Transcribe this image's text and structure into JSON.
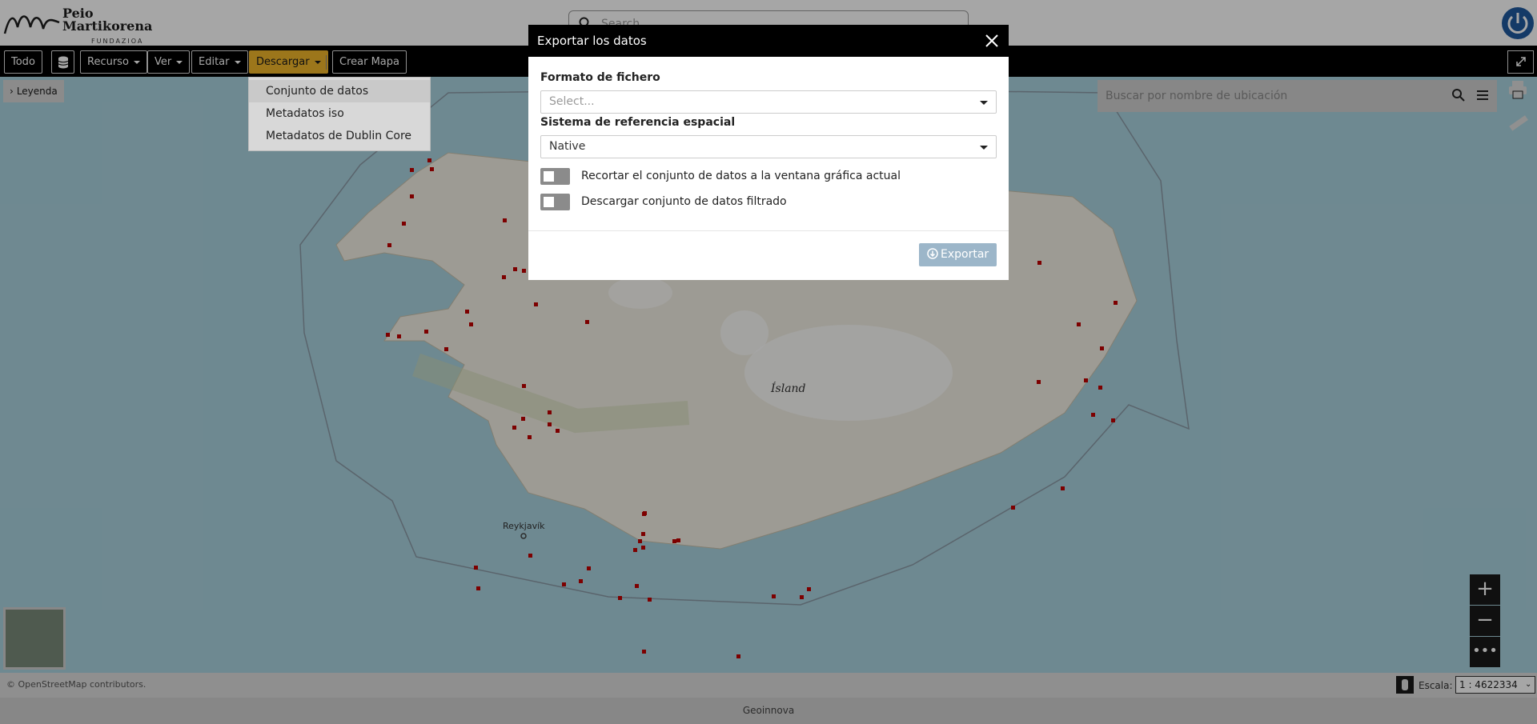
{
  "header": {
    "logo_line1": "Peio",
    "logo_line2": "Martikorena",
    "logo_sub": "FUNDAZIOA",
    "search_placeholder": "Search"
  },
  "toolbar": {
    "todo": "Todo",
    "recurso": "Recurso",
    "ver": "Ver",
    "editar": "Editar",
    "descargar": "Descargar",
    "crear_mapa": "Crear Mapa"
  },
  "download_menu": {
    "items": [
      "Conjunto de datos",
      "Metadatos iso",
      "Metadatos de Dublin Core"
    ]
  },
  "map": {
    "legend_label": "Leyenda",
    "location_search_placeholder": "Buscar por nombre de ubicación",
    "island_label": "Ísland",
    "city_label": "Reykjavík"
  },
  "status": {
    "attribution": "© OpenStreetMap contributors.",
    "scale_label": "Escala:",
    "scale_value": "1 : 4622334",
    "footer": "Geoinnova"
  },
  "modal": {
    "title": "Exportar los datos",
    "format_label": "Formato de fichero",
    "format_placeholder": "Select...",
    "srs_label": "Sistema de referencia espacial",
    "srs_value": "Native",
    "crop_label": "Recortar el conjunto de datos a la ventana gráfica actual",
    "filtered_label": "Descargar conjunto de datos filtrado",
    "export_button": "Exportar"
  },
  "colors": {
    "toolbar_bg": "#000000",
    "active_menu": "#f0b52a",
    "export_button": "#9cb6c9",
    "marker": "#c00000"
  }
}
